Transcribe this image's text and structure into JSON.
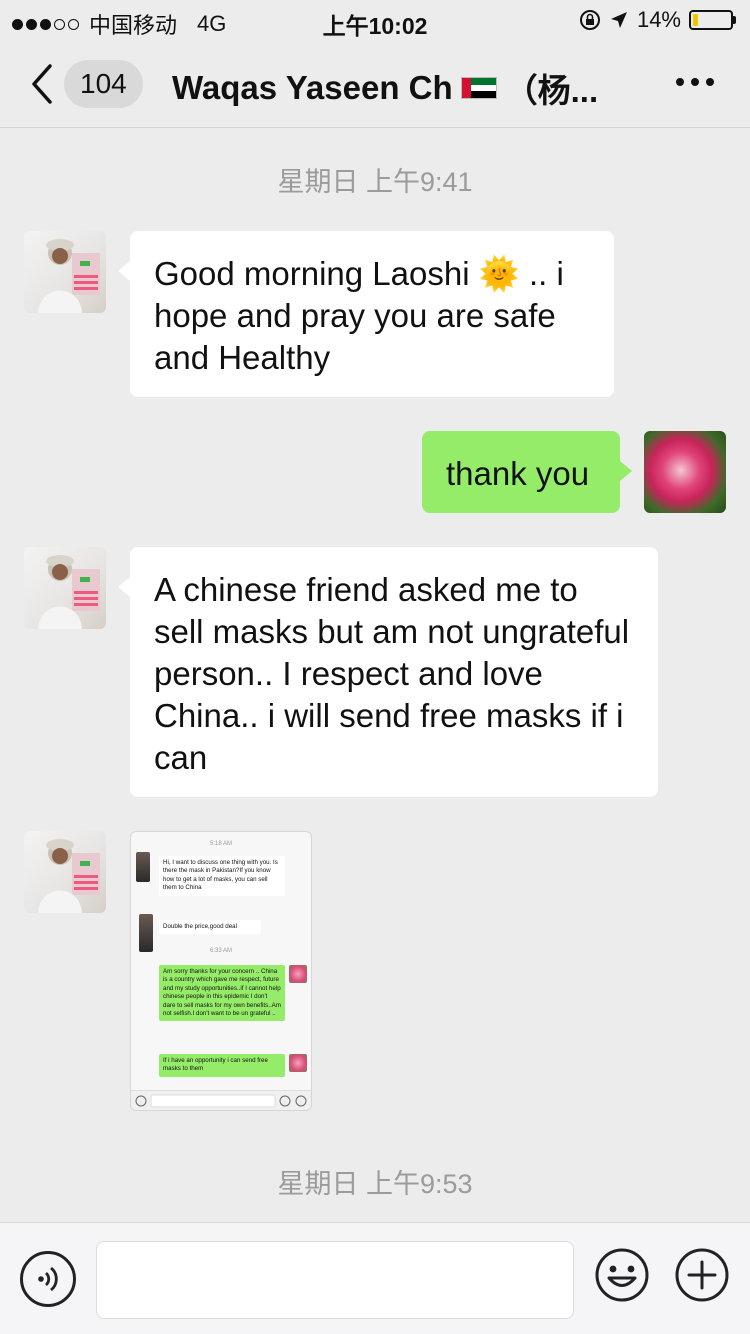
{
  "status_bar": {
    "carrier": "中国移动",
    "network": "4G",
    "time": "上午10:02",
    "battery": "14%",
    "battery_level": 0.14,
    "signal_bars": 3
  },
  "nav": {
    "badge_count": "104",
    "title": "Waqas Yaseen Ch",
    "title_suffix": "（杨..."
  },
  "messages": [
    {
      "timestamp": "星期日 上午9:41"
    },
    {
      "sender": "contact",
      "text": "Good morning Laoshi 🌞  .. i hope and pray you are safe and Healthy"
    },
    {
      "sender": "me",
      "text": "thank you"
    },
    {
      "sender": "contact",
      "text": "A chinese friend asked me to sell masks but am not ungrateful person.. I respect and love China.. i will send free masks if i can"
    },
    {
      "sender": "contact",
      "type": "image"
    },
    {
      "timestamp": "星期日 上午9:53"
    }
  ],
  "image_message": {
    "ts1": "5:18 AM",
    "in1": "Hi, I want to discuss one thing with you. Is there the mask in Pakistan?If you know how to get a lot of masks, you can sell them to China",
    "in2": "Double the price,good deal",
    "ts2": "6:33 AM",
    "out1": "Am sorry thanks for your concern .. China is a country which gave me respect, future and my study opportunities..if I cannot help chinese people in this epidemic I don't dare to sell masks for my own benefits..Am not selfish.I don't want to be un grateful ..",
    "out2": "If i have an opportunity i can send free masks to them"
  },
  "input_bar": {
    "message_value": ""
  },
  "colors": {
    "background": "#ececec",
    "incoming_bubble": "#ffffff",
    "outgoing_bubble": "#95ec69",
    "timestamp_text": "#9b9b9b",
    "battery_fill": "#f5c400"
  },
  "icons": [
    "signal-dots-icon",
    "location-arrow-icon",
    "rotation-lock-icon",
    "battery-icon",
    "back-chevron-icon",
    "more-dots-icon",
    "voice-icon",
    "emoji-icon",
    "plus-icon",
    "uae-flag-icon"
  ]
}
